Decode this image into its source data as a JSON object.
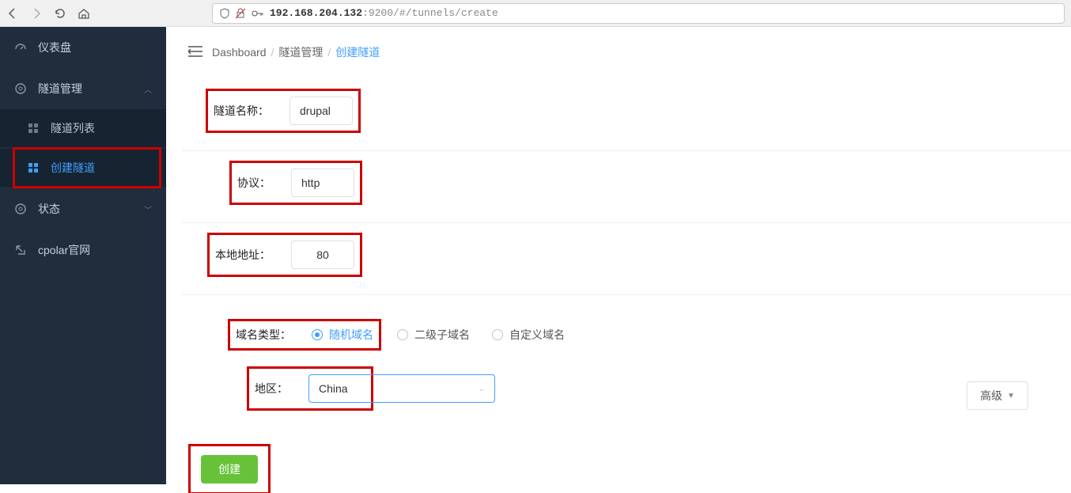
{
  "browser": {
    "url_host": "192.168.204.132",
    "url_rest": ":9200/#/tunnels/create"
  },
  "sidebar": {
    "dashboard": "仪表盘",
    "tunnel_mgmt": "隧道管理",
    "tunnel_list": "隧道列表",
    "create_tunnel": "创建隧道",
    "status": "状态",
    "cpolar": "cpolar官网"
  },
  "breadcrumb": {
    "a": "Dashboard",
    "b": "隧道管理",
    "c": "创建隧道"
  },
  "form": {
    "name_label": "隧道名称：",
    "name_value": "drupal",
    "proto_label": "协议：",
    "proto_value": "http",
    "addr_label": "本地地址：",
    "addr_value": "80",
    "domain_label": "域名类型：",
    "domain_opts": {
      "random": "随机域名",
      "sub": "二级子域名",
      "custom": "自定义域名"
    },
    "region_label": "地区：",
    "region_value": "China",
    "advanced": "高级",
    "create": "创建"
  }
}
